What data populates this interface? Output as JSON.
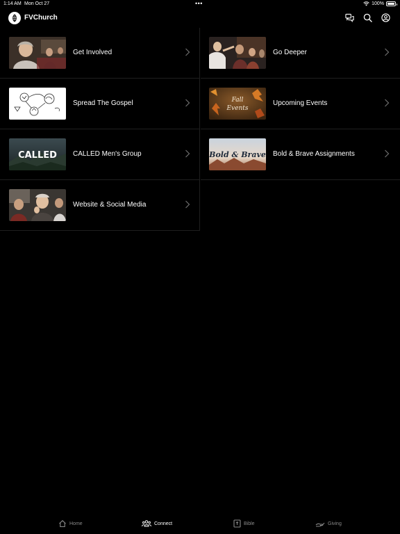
{
  "status_bar": {
    "time": "1:14 AM",
    "date": "Mon Oct 27",
    "dots": "•••",
    "battery": "100%"
  },
  "header": {
    "brand": "FVChurch",
    "icons": [
      "chat-icon",
      "search-icon",
      "account-icon"
    ]
  },
  "menu": {
    "items": [
      {
        "label": "Get Involved",
        "thumb": "get-involved-thumb"
      },
      {
        "label": "Go Deeper",
        "thumb": "go-deeper-thumb"
      },
      {
        "label": "Spread The Gospel",
        "thumb": "spread-the-gospel-thumb"
      },
      {
        "label": "Upcoming Events",
        "thumb": "upcoming-events-thumb",
        "thumb_text": [
          "Fall",
          "Events"
        ]
      },
      {
        "label": "CALLED Men's Group",
        "thumb": "called-thumb",
        "thumb_text": "CALLED"
      },
      {
        "label": "Bold & Brave Assignments",
        "thumb": "bold-brave-thumb",
        "thumb_text": "Bold & Brave"
      },
      {
        "label": "Website & Social Media",
        "thumb": "website-social-thumb"
      }
    ]
  },
  "tabs": [
    {
      "label": "Home",
      "icon": "home-icon",
      "active": false
    },
    {
      "label": "Connect",
      "icon": "people-icon",
      "active": true
    },
    {
      "label": "Bible",
      "icon": "bible-icon",
      "active": false
    },
    {
      "label": "Giving",
      "icon": "giving-icon",
      "active": false
    }
  ],
  "colors": {
    "background": "#000000",
    "divider": "#1f1f1f",
    "inactive_tab": "#8a8a8a",
    "text": "#ffffff"
  }
}
